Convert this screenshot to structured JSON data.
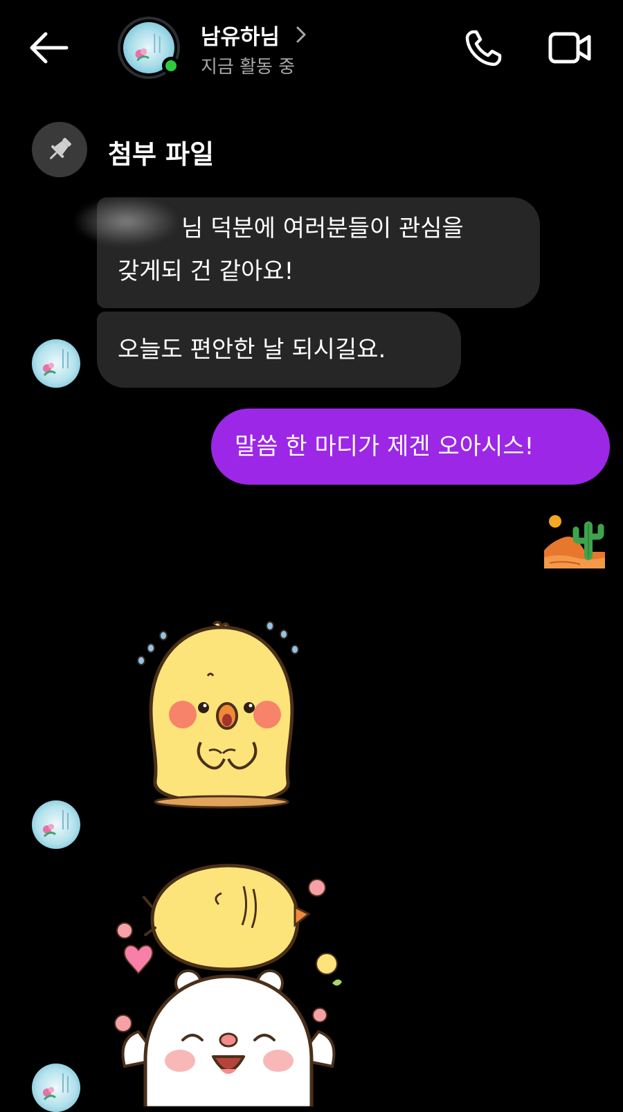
{
  "header": {
    "contact_name": "남유하님",
    "status": "지금 활동 중",
    "online": true
  },
  "pinned": {
    "label": "첨부 파일"
  },
  "messages": [
    {
      "direction": "incoming",
      "lines": [
        "님 덕분에 여러분들이 관심을",
        "갖게되 건 같아요!"
      ]
    },
    {
      "direction": "incoming",
      "text": "오늘도 편안한 날 되시길요."
    },
    {
      "direction": "outgoing",
      "text": "말씀 한 마디가 제겐 오아시스!"
    }
  ],
  "colors": {
    "background": "#000000",
    "incoming_bubble": "#262626",
    "outgoing_bubble": "#9c27e6",
    "online_indicator": "#2ecb3f",
    "secondary_text": "#a8a8a8"
  },
  "icons": {
    "back": "arrow-left-icon",
    "call": "phone-icon",
    "video": "video-camera-icon",
    "pin": "pin-icon",
    "chevron": "chevron-right-icon",
    "emoji": "desert-cactus-emoji"
  }
}
